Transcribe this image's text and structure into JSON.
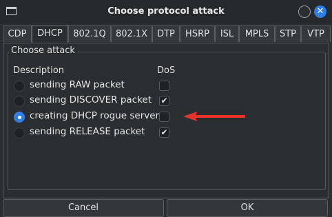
{
  "window": {
    "title": "Choose protocol attack"
  },
  "tabs": [
    {
      "label": "CDP"
    },
    {
      "label": "DHCP",
      "active": true
    },
    {
      "label": "802.1Q"
    },
    {
      "label": "802.1X"
    },
    {
      "label": "DTP"
    },
    {
      "label": "HSRP"
    },
    {
      "label": "ISL"
    },
    {
      "label": "MPLS"
    },
    {
      "label": "STP"
    },
    {
      "label": "VTP"
    }
  ],
  "group": {
    "title": "Choose attack",
    "col_description": "Description",
    "col_dos": "DoS"
  },
  "attacks": [
    {
      "label": "sending RAW packet",
      "selected": false,
      "dos": false
    },
    {
      "label": "sending DISCOVER packet",
      "selected": false,
      "dos": true
    },
    {
      "label": "creating DHCP rogue server",
      "selected": true,
      "dos": false
    },
    {
      "label": "sending RELEASE packet",
      "selected": false,
      "dos": true
    }
  ],
  "buttons": {
    "cancel": "Cancel",
    "ok": "OK"
  },
  "colors": {
    "accent": "#2f7ee6",
    "annotation_arrow": "#e8322a"
  }
}
